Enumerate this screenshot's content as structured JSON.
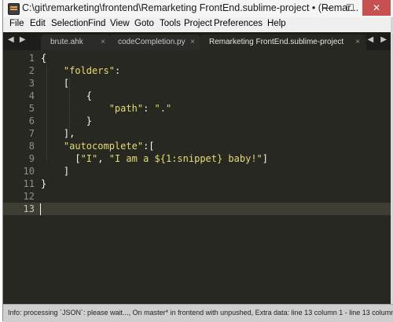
{
  "window": {
    "title": "C:\\git\\remarketing\\frontend\\Remarketing FrontEnd.sublime-project • (Remar...",
    "minimize_glyph": "—",
    "maximize_glyph": "☐",
    "close_glyph": "✕"
  },
  "menu": {
    "items": [
      "File",
      "Edit",
      "Selection",
      "Find",
      "View",
      "Goto",
      "Tools",
      "Project",
      "Preferences",
      "Help"
    ]
  },
  "tabs": {
    "nav_arrows": "◀ ▶",
    "scroll_arrows": "◀ ▶",
    "items": [
      {
        "label": "brute.ahk",
        "close": "×",
        "active": false
      },
      {
        "label": "codeCompletion.py",
        "close": "×",
        "active": false
      },
      {
        "label": "Remarketing FrontEnd.sublime-project",
        "close": "×",
        "active": true
      }
    ]
  },
  "editor": {
    "current_line": 13,
    "line_numbers": [
      "1",
      "2",
      "3",
      "4",
      "5",
      "6",
      "7",
      "8",
      "9",
      "10",
      "11",
      "12",
      "13"
    ],
    "lines": [
      {
        "text": "{"
      },
      {
        "indent": "    ",
        "str": "\"folders\"",
        "rest": ":"
      },
      {
        "text": "    ["
      },
      {
        "text": "        {"
      },
      {
        "indent": "            ",
        "str": "\"path\"",
        "mid": ": ",
        "str2": "\".\""
      },
      {
        "text": "        }"
      },
      {
        "text": "    ],"
      },
      {
        "indent": "    ",
        "str": "\"autocomplete\"",
        "rest": ":["
      },
      {
        "indent": "      [",
        "str": "\"I\"",
        "mid": ", ",
        "str2": "\"I am a ${1:snippet} baby!\"",
        "rest": "]"
      },
      {
        "text": "    ]"
      },
      {
        "text": "}"
      },
      {
        "text": ""
      },
      {
        "text": ""
      }
    ]
  },
  "status": {
    "text": "Info: processing `JSON`: please wait..., On master* in frontend with unpushed, Extra data: line 13 column 1 - line 13 column 1"
  },
  "colors": {
    "editor_bg": "#272822",
    "string": "#e6db74",
    "text": "#f8f8f2",
    "gutter_text": "#8f908a"
  }
}
